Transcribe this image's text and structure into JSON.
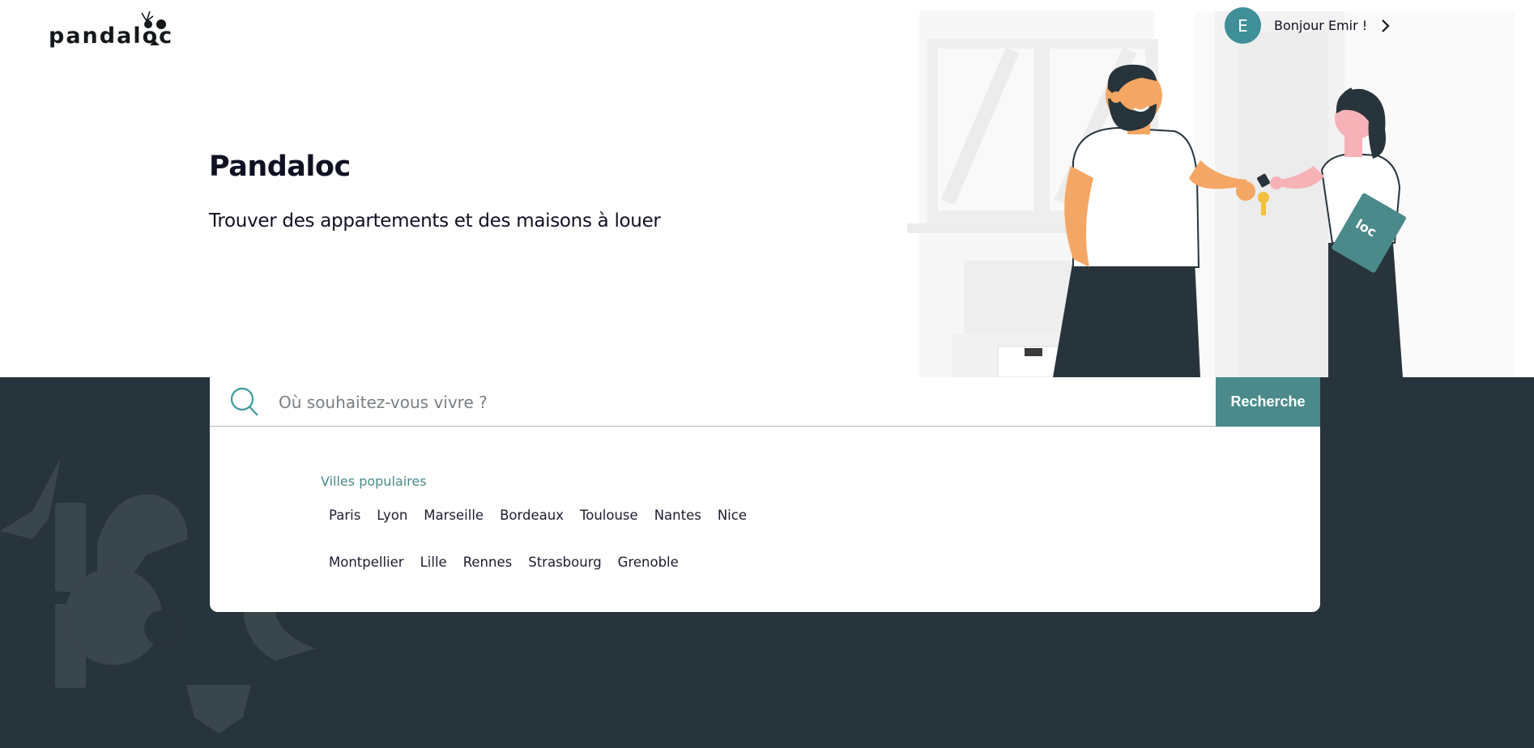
{
  "brand": {
    "logo_text": "pandaloc"
  },
  "hero": {
    "title": "Pandaloc",
    "subtitle": "Trouver des appartements et des maisons à louer"
  },
  "user": {
    "initial": "E",
    "greeting": "Bonjour Emir !"
  },
  "search": {
    "placeholder": "Où souhaitez-vous vivre ?",
    "button_label": "Recherche"
  },
  "popular": {
    "label": "Villes populaires",
    "cities": [
      "Paris",
      "Lyon",
      "Marseille",
      "Bordeaux",
      "Toulouse",
      "Nantes",
      "Nice",
      "Montpellier",
      "Lille",
      "Rennes",
      "Strasbourg",
      "Grenoble"
    ]
  },
  "colors": {
    "accent": "#4b8a8a",
    "avatar": "#3e8f98",
    "dark_band": "#28343b",
    "text": "#0f1022"
  },
  "icons": [
    "panda-logo-icon",
    "search-icon",
    "chevron-right-icon"
  ]
}
